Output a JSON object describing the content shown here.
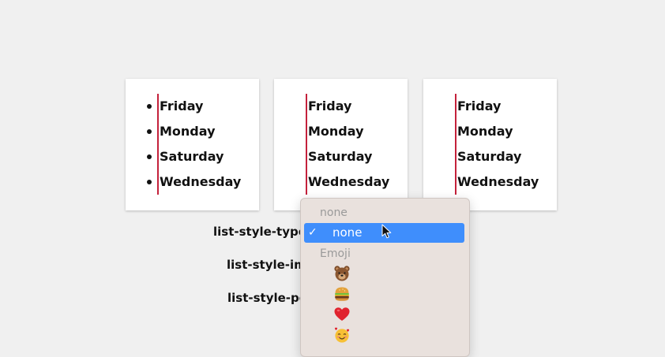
{
  "cards": [
    {
      "items": [
        "Friday",
        "Monday",
        "Saturday",
        "Wednesday"
      ]
    },
    {
      "items": [
        "Friday",
        "Monday",
        "Saturday",
        "Wednesday"
      ]
    },
    {
      "items": [
        "Friday",
        "Monday",
        "Saturday",
        "Wednesday"
      ]
    }
  ],
  "controls": {
    "type_label": "list-style-type:",
    "image_label": "list-style-ima",
    "position_label": "list-style-pos"
  },
  "dropdown": {
    "group_none_header": "none",
    "selected_label": "none",
    "check_glyph": "✓",
    "group_emoji_header": "Emoji",
    "emoji_options": [
      "bear-face-icon",
      "hamburger-icon",
      "red-heart-icon",
      "smiling-face-with-hearts-icon"
    ]
  },
  "colors": {
    "page_background": "#f0f0f0",
    "card_background": "#ffffff",
    "accent_line": "#c4213b",
    "dropdown_background": "#e9e1dd",
    "selection_highlight": "#3f8efc",
    "group_header_text": "#9a9a9a"
  }
}
